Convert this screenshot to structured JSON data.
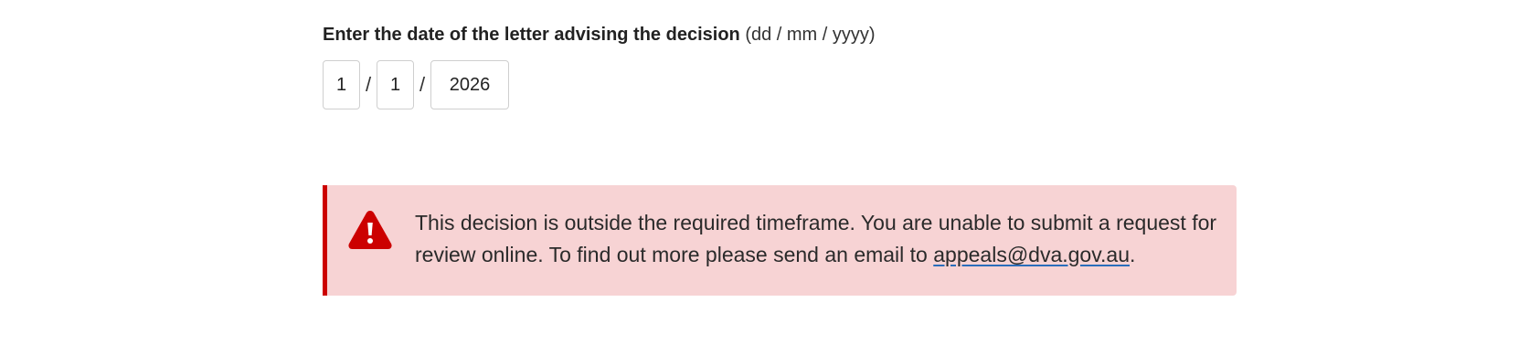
{
  "date_field": {
    "label": "Enter the date of the letter advising the decision",
    "hint": "(dd / mm / yyyy)",
    "day_value": "1",
    "month_value": "1",
    "year_value": "2026",
    "separator": "/"
  },
  "alert": {
    "type": "error",
    "icon": "warning-triangle-icon",
    "accent_color": "#cc0000",
    "background_color": "#f7d3d4",
    "message_before": "This decision is outside the required timeframe. You are unable to submit a request for review online. To find out more please send an email to ",
    "link_text": "appeals@dva.gov.au",
    "message_after": "."
  }
}
